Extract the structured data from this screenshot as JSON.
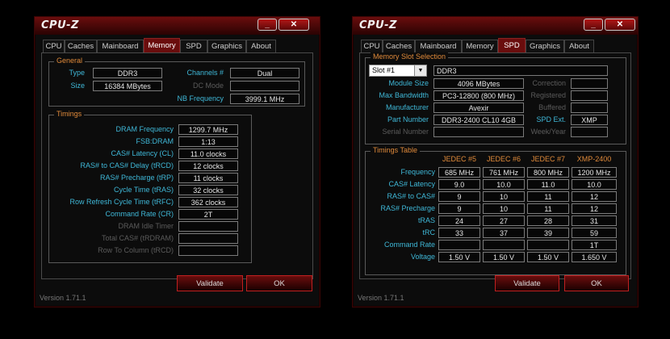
{
  "left": {
    "title": "CPU-Z",
    "minimize": "_",
    "close": "✕",
    "tabs": [
      "CPU",
      "Caches",
      "Mainboard",
      "Memory",
      "SPD",
      "Graphics",
      "About"
    ],
    "active_tab": "Memory",
    "general": {
      "title": "General",
      "type_label": "Type",
      "type": "DDR3",
      "size_label": "Size",
      "size": "16384 MBytes",
      "channels_label": "Channels #",
      "channels": "Dual",
      "dcmode_label": "DC Mode",
      "dcmode": "",
      "nbfreq_label": "NB Frequency",
      "nbfreq": "3999.1 MHz"
    },
    "timings": {
      "title": "Timings",
      "rows": [
        {
          "label": "DRAM Frequency",
          "value": "1299.7 MHz",
          "dim": false
        },
        {
          "label": "FSB:DRAM",
          "value": "1:13",
          "dim": false
        },
        {
          "label": "CAS# Latency (CL)",
          "value": "11.0 clocks",
          "dim": false
        },
        {
          "label": "RAS# to CAS# Delay (tRCD)",
          "value": "12 clocks",
          "dim": false
        },
        {
          "label": "RAS# Precharge (tRP)",
          "value": "11 clocks",
          "dim": false
        },
        {
          "label": "Cycle Time (tRAS)",
          "value": "32 clocks",
          "dim": false
        },
        {
          "label": "Row Refresh Cycle Time (tRFC)",
          "value": "362 clocks",
          "dim": false
        },
        {
          "label": "Command Rate (CR)",
          "value": "2T",
          "dim": false
        },
        {
          "label": "DRAM Idle Timer",
          "value": "",
          "dim": true
        },
        {
          "label": "Total CAS# (tRDRAM)",
          "value": "",
          "dim": true
        },
        {
          "label": "Row To Column (tRCD)",
          "value": "",
          "dim": true
        }
      ]
    },
    "validate": "Validate",
    "ok": "OK",
    "version": "Version 1.71.1"
  },
  "right": {
    "title": "CPU-Z",
    "minimize": "_",
    "close": "✕",
    "tabs": [
      "CPU",
      "Caches",
      "Mainboard",
      "Memory",
      "SPD",
      "Graphics",
      "About"
    ],
    "active_tab": "SPD",
    "slot": {
      "title": "Memory Slot Selection",
      "selected": "Slot #1",
      "type": "DDR3",
      "module_size_label": "Module Size",
      "module_size": "4096 MBytes",
      "bandwidth_label": "Max Bandwidth",
      "bandwidth": "PC3-12800 (800 MHz)",
      "manufacturer_label": "Manufacturer",
      "manufacturer": "Avexir",
      "part_label": "Part Number",
      "part": "DDR3-2400 CL10 4GB",
      "serial_label": "Serial Number",
      "serial": "",
      "correction_label": "Correction",
      "correction": "",
      "registered_label": "Registered",
      "registered": "",
      "buffered_label": "Buffered",
      "buffered": "",
      "spdext_label": "SPD Ext.",
      "spdext": "XMP",
      "weekyear_label": "Week/Year",
      "weekyear": ""
    },
    "timings_table": {
      "title": "Timings Table",
      "columns": [
        "JEDEC #5",
        "JEDEC #6",
        "JEDEC #7",
        "XMP-2400"
      ],
      "rows": [
        {
          "label": "Frequency",
          "values": [
            "685 MHz",
            "761 MHz",
            "800 MHz",
            "1200 MHz"
          ]
        },
        {
          "label": "CAS# Latency",
          "values": [
            "9.0",
            "10.0",
            "11.0",
            "10.0"
          ]
        },
        {
          "label": "RAS# to CAS#",
          "values": [
            "9",
            "10",
            "11",
            "12"
          ]
        },
        {
          "label": "RAS# Precharge",
          "values": [
            "9",
            "10",
            "11",
            "12"
          ]
        },
        {
          "label": "tRAS",
          "values": [
            "24",
            "27",
            "28",
            "31"
          ]
        },
        {
          "label": "tRC",
          "values": [
            "33",
            "37",
            "39",
            "59"
          ]
        },
        {
          "label": "Command Rate",
          "values": [
            "",
            "",
            "",
            "1T"
          ]
        },
        {
          "label": "Voltage",
          "values": [
            "1.50 V",
            "1.50 V",
            "1.50 V",
            "1.650 V"
          ]
        }
      ]
    },
    "validate": "Validate",
    "ok": "OK",
    "version": "Version 1.71.1"
  }
}
